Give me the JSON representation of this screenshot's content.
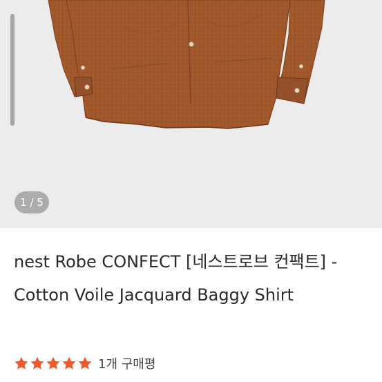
{
  "gallery": {
    "counter": "1 / 5"
  },
  "product": {
    "title": "nest Robe CONFECT [네스트로브 컨팩트] - Cotton Voile Jacquard Baggy Shirt"
  },
  "rating": {
    "stars": 5,
    "text": "1개 구매평",
    "star_color": "#f05a2a"
  },
  "colors": {
    "shirt": "#a0582a",
    "shirt_dark": "#7d4220",
    "background": "#ececec"
  }
}
